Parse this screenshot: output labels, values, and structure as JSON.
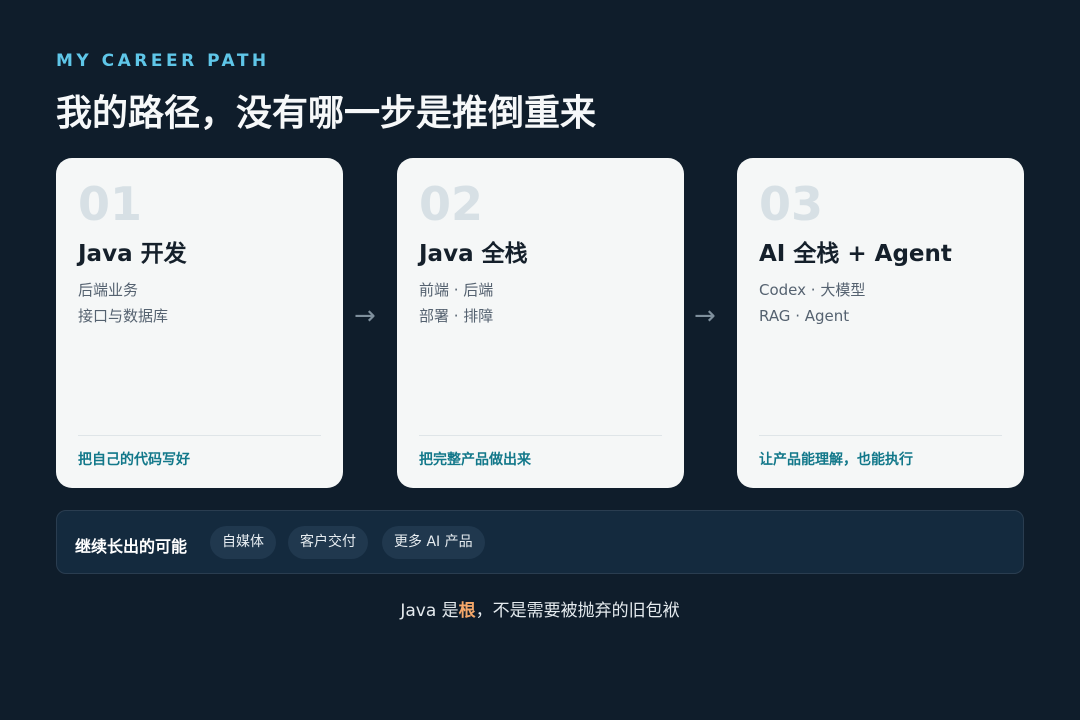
{
  "header": {
    "eyebrow": "MY CAREER PATH",
    "title": "我的路径，没有哪一步是推倒重来"
  },
  "cards": [
    {
      "number": "01",
      "title": "Java 开发",
      "lines": [
        "后端业务",
        "接口与数据库"
      ],
      "tagline": "把自己的代码写好"
    },
    {
      "number": "02",
      "title": "Java 全栈",
      "lines": [
        "前端 · 后端",
        "部署 · 排障"
      ],
      "tagline": "把完整产品做出来"
    },
    {
      "number": "03",
      "title": "AI 全栈 + Agent",
      "lines": [
        "Codex · 大模型",
        "RAG · Agent"
      ],
      "tagline": "让产品能理解，也能执行"
    }
  ],
  "arrow_glyph": "→",
  "possibilities": {
    "label": "继续长出的可能",
    "chips": [
      "自媒体",
      "客户交付",
      "更多 AI 产品"
    ]
  },
  "footer": {
    "prefix": "Java 是",
    "highlight": "根",
    "suffix": "，不是需要被抛弃的旧包袱"
  },
  "colors": {
    "background": "#0f1d2b",
    "eyebrow": "#5fc6e8",
    "card": "#f5f7f7",
    "tagline": "#12788a",
    "highlight": "#f5a86a"
  }
}
